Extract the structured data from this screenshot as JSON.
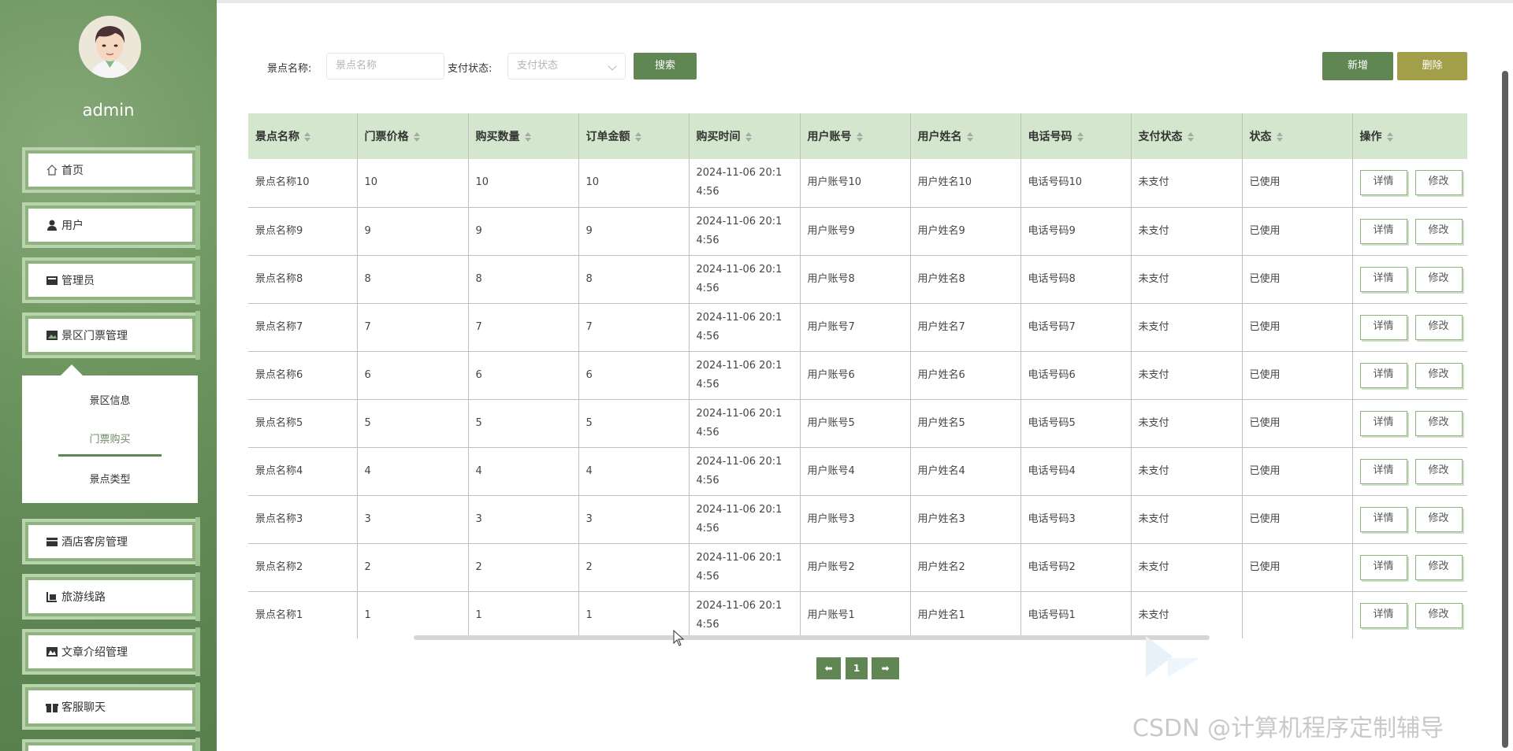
{
  "sidebar": {
    "username": "admin",
    "items": [
      {
        "label": "首页",
        "icon": "home-icon"
      },
      {
        "label": "用户",
        "icon": "user-icon"
      },
      {
        "label": "管理员",
        "icon": "admin-icon"
      },
      {
        "label": "景区门票管理",
        "icon": "image-icon"
      },
      {
        "label": "酒店客房管理",
        "icon": "hotel-icon"
      },
      {
        "label": "旅游线路",
        "icon": "route-icon"
      },
      {
        "label": "文章介绍管理",
        "icon": "article-icon"
      },
      {
        "label": "客服聊天",
        "icon": "gift-icon"
      }
    ],
    "submenu": [
      {
        "label": "景区信息"
      },
      {
        "label": "门票购买"
      },
      {
        "label": "景点类型"
      }
    ]
  },
  "search": {
    "name_label": "景点名称:",
    "name_placeholder": "景点名称",
    "status_label": "支付状态:",
    "status_placeholder": "支付状态",
    "search_button": "搜索"
  },
  "toolbar": {
    "add_label": "新增",
    "delete_label": "删除"
  },
  "table": {
    "headers": [
      "景点名称",
      "门票价格",
      "购买数量",
      "订单金额",
      "购买时间",
      "用户账号",
      "用户姓名",
      "电话号码",
      "支付状态",
      "状态",
      "操作"
    ],
    "rows": [
      [
        "景点名称10",
        "10",
        "10",
        "10",
        "2024-11-06 20:14:56",
        "用户账号10",
        "用户姓名10",
        "电话号码10",
        "未支付",
        "已使用"
      ],
      [
        "景点名称9",
        "9",
        "9",
        "9",
        "2024-11-06 20:14:56",
        "用户账号9",
        "用户姓名9",
        "电话号码9",
        "未支付",
        "已使用"
      ],
      [
        "景点名称8",
        "8",
        "8",
        "8",
        "2024-11-06 20:14:56",
        "用户账号8",
        "用户姓名8",
        "电话号码8",
        "未支付",
        "已使用"
      ],
      [
        "景点名称7",
        "7",
        "7",
        "7",
        "2024-11-06 20:14:56",
        "用户账号7",
        "用户姓名7",
        "电话号码7",
        "未支付",
        "已使用"
      ],
      [
        "景点名称6",
        "6",
        "6",
        "6",
        "2024-11-06 20:14:56",
        "用户账号6",
        "用户姓名6",
        "电话号码6",
        "未支付",
        "已使用"
      ],
      [
        "景点名称5",
        "5",
        "5",
        "5",
        "2024-11-06 20:14:56",
        "用户账号5",
        "用户姓名5",
        "电话号码5",
        "未支付",
        "已使用"
      ],
      [
        "景点名称4",
        "4",
        "4",
        "4",
        "2024-11-06 20:14:56",
        "用户账号4",
        "用户姓名4",
        "电话号码4",
        "未支付",
        "已使用"
      ],
      [
        "景点名称3",
        "3",
        "3",
        "3",
        "2024-11-06 20:14:56",
        "用户账号3",
        "用户姓名3",
        "电话号码3",
        "未支付",
        "已使用"
      ],
      [
        "景点名称2",
        "2",
        "2",
        "2",
        "2024-11-06 20:14:56",
        "用户账号2",
        "用户姓名2",
        "电话号码2",
        "未支付",
        "已使用"
      ],
      [
        "景点名称1",
        "1",
        "1",
        "1",
        "2024-11-06 20:14:56",
        "用户账号1",
        "用户姓名1",
        "电话号码1",
        "未支付",
        ""
      ]
    ],
    "detail_label": "详情",
    "edit_label": "修改"
  },
  "pagination": {
    "prev": "⬅",
    "page": "1",
    "next": "➡"
  },
  "watermark": "CSDN @计算机程序定制辅导",
  "colors": {
    "primary": "#5f8653",
    "delete": "#a29f4a",
    "header_bg": "#d5e6ce"
  }
}
